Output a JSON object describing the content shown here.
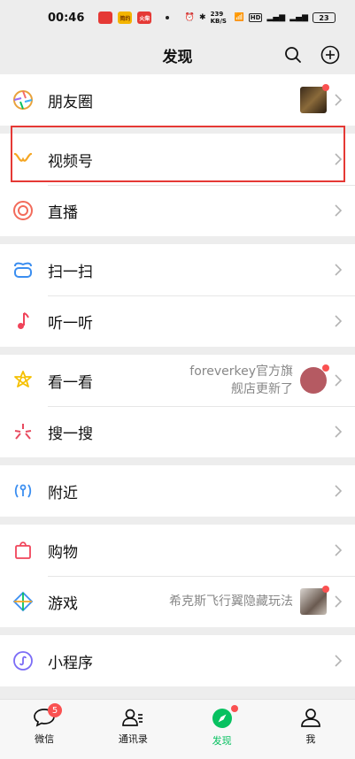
{
  "status_bar": {
    "time": "00:46",
    "speed": "239 KB/S",
    "battery": "23",
    "badges": [
      "",
      "简约",
      "火柴"
    ]
  },
  "header": {
    "title": "发现"
  },
  "groups": [
    {
      "items": [
        {
          "label": "朋友圈",
          "icon": "moments-icon"
        }
      ]
    },
    {
      "items": [
        {
          "label": "视频号",
          "icon": "channels-icon"
        },
        {
          "label": "直播",
          "icon": "live-icon"
        }
      ]
    },
    {
      "items": [
        {
          "label": "扫一扫",
          "icon": "scan-icon"
        },
        {
          "label": "听一听",
          "icon": "listen-icon"
        }
      ]
    },
    {
      "items": [
        {
          "label": "看一看",
          "icon": "top-stories-icon",
          "note_line1": "foreverkey官方旗",
          "note_line2": "舰店更新了"
        },
        {
          "label": "搜一搜",
          "icon": "search-icon"
        }
      ]
    },
    {
      "items": [
        {
          "label": "附近",
          "icon": "nearby-icon"
        }
      ]
    },
    {
      "items": [
        {
          "label": "购物",
          "icon": "shopping-icon"
        },
        {
          "label": "游戏",
          "icon": "games-icon",
          "note": "希克斯飞行翼隐藏玩法"
        }
      ]
    },
    {
      "items": [
        {
          "label": "小程序",
          "icon": "mini-programs-icon"
        }
      ]
    }
  ],
  "tabs": [
    {
      "label": "微信",
      "badge": "5"
    },
    {
      "label": "通讯录"
    },
    {
      "label": "发现"
    },
    {
      "label": "我"
    }
  ],
  "colors": {
    "accent": "#07c160",
    "badge": "#fa5151",
    "highlight": "#e53935"
  }
}
